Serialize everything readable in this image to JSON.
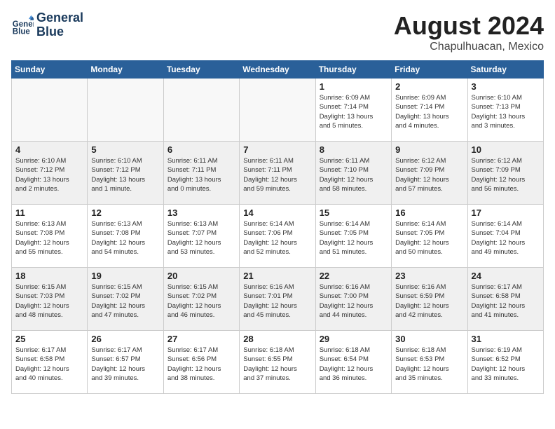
{
  "header": {
    "logo_line1": "General",
    "logo_line2": "Blue",
    "month_year": "August 2024",
    "location": "Chapulhuacan, Mexico"
  },
  "days_of_week": [
    "Sunday",
    "Monday",
    "Tuesday",
    "Wednesday",
    "Thursday",
    "Friday",
    "Saturday"
  ],
  "weeks": [
    [
      {
        "day": "",
        "info": "",
        "empty": true
      },
      {
        "day": "",
        "info": "",
        "empty": true
      },
      {
        "day": "",
        "info": "",
        "empty": true
      },
      {
        "day": "",
        "info": "",
        "empty": true
      },
      {
        "day": "1",
        "info": "Sunrise: 6:09 AM\nSunset: 7:14 PM\nDaylight: 13 hours\nand 5 minutes."
      },
      {
        "day": "2",
        "info": "Sunrise: 6:09 AM\nSunset: 7:14 PM\nDaylight: 13 hours\nand 4 minutes."
      },
      {
        "day": "3",
        "info": "Sunrise: 6:10 AM\nSunset: 7:13 PM\nDaylight: 13 hours\nand 3 minutes."
      }
    ],
    [
      {
        "day": "4",
        "info": "Sunrise: 6:10 AM\nSunset: 7:12 PM\nDaylight: 13 hours\nand 2 minutes."
      },
      {
        "day": "5",
        "info": "Sunrise: 6:10 AM\nSunset: 7:12 PM\nDaylight: 13 hours\nand 1 minute."
      },
      {
        "day": "6",
        "info": "Sunrise: 6:11 AM\nSunset: 7:11 PM\nDaylight: 13 hours\nand 0 minutes."
      },
      {
        "day": "7",
        "info": "Sunrise: 6:11 AM\nSunset: 7:11 PM\nDaylight: 12 hours\nand 59 minutes."
      },
      {
        "day": "8",
        "info": "Sunrise: 6:11 AM\nSunset: 7:10 PM\nDaylight: 12 hours\nand 58 minutes."
      },
      {
        "day": "9",
        "info": "Sunrise: 6:12 AM\nSunset: 7:09 PM\nDaylight: 12 hours\nand 57 minutes."
      },
      {
        "day": "10",
        "info": "Sunrise: 6:12 AM\nSunset: 7:09 PM\nDaylight: 12 hours\nand 56 minutes."
      }
    ],
    [
      {
        "day": "11",
        "info": "Sunrise: 6:13 AM\nSunset: 7:08 PM\nDaylight: 12 hours\nand 55 minutes."
      },
      {
        "day": "12",
        "info": "Sunrise: 6:13 AM\nSunset: 7:08 PM\nDaylight: 12 hours\nand 54 minutes."
      },
      {
        "day": "13",
        "info": "Sunrise: 6:13 AM\nSunset: 7:07 PM\nDaylight: 12 hours\nand 53 minutes."
      },
      {
        "day": "14",
        "info": "Sunrise: 6:14 AM\nSunset: 7:06 PM\nDaylight: 12 hours\nand 52 minutes."
      },
      {
        "day": "15",
        "info": "Sunrise: 6:14 AM\nSunset: 7:05 PM\nDaylight: 12 hours\nand 51 minutes."
      },
      {
        "day": "16",
        "info": "Sunrise: 6:14 AM\nSunset: 7:05 PM\nDaylight: 12 hours\nand 50 minutes."
      },
      {
        "day": "17",
        "info": "Sunrise: 6:14 AM\nSunset: 7:04 PM\nDaylight: 12 hours\nand 49 minutes."
      }
    ],
    [
      {
        "day": "18",
        "info": "Sunrise: 6:15 AM\nSunset: 7:03 PM\nDaylight: 12 hours\nand 48 minutes."
      },
      {
        "day": "19",
        "info": "Sunrise: 6:15 AM\nSunset: 7:02 PM\nDaylight: 12 hours\nand 47 minutes."
      },
      {
        "day": "20",
        "info": "Sunrise: 6:15 AM\nSunset: 7:02 PM\nDaylight: 12 hours\nand 46 minutes."
      },
      {
        "day": "21",
        "info": "Sunrise: 6:16 AM\nSunset: 7:01 PM\nDaylight: 12 hours\nand 45 minutes."
      },
      {
        "day": "22",
        "info": "Sunrise: 6:16 AM\nSunset: 7:00 PM\nDaylight: 12 hours\nand 44 minutes."
      },
      {
        "day": "23",
        "info": "Sunrise: 6:16 AM\nSunset: 6:59 PM\nDaylight: 12 hours\nand 42 minutes."
      },
      {
        "day": "24",
        "info": "Sunrise: 6:17 AM\nSunset: 6:58 PM\nDaylight: 12 hours\nand 41 minutes."
      }
    ],
    [
      {
        "day": "25",
        "info": "Sunrise: 6:17 AM\nSunset: 6:58 PM\nDaylight: 12 hours\nand 40 minutes."
      },
      {
        "day": "26",
        "info": "Sunrise: 6:17 AM\nSunset: 6:57 PM\nDaylight: 12 hours\nand 39 minutes."
      },
      {
        "day": "27",
        "info": "Sunrise: 6:17 AM\nSunset: 6:56 PM\nDaylight: 12 hours\nand 38 minutes."
      },
      {
        "day": "28",
        "info": "Sunrise: 6:18 AM\nSunset: 6:55 PM\nDaylight: 12 hours\nand 37 minutes."
      },
      {
        "day": "29",
        "info": "Sunrise: 6:18 AM\nSunset: 6:54 PM\nDaylight: 12 hours\nand 36 minutes."
      },
      {
        "day": "30",
        "info": "Sunrise: 6:18 AM\nSunset: 6:53 PM\nDaylight: 12 hours\nand 35 minutes."
      },
      {
        "day": "31",
        "info": "Sunrise: 6:19 AM\nSunset: 6:52 PM\nDaylight: 12 hours\nand 33 minutes."
      }
    ]
  ]
}
